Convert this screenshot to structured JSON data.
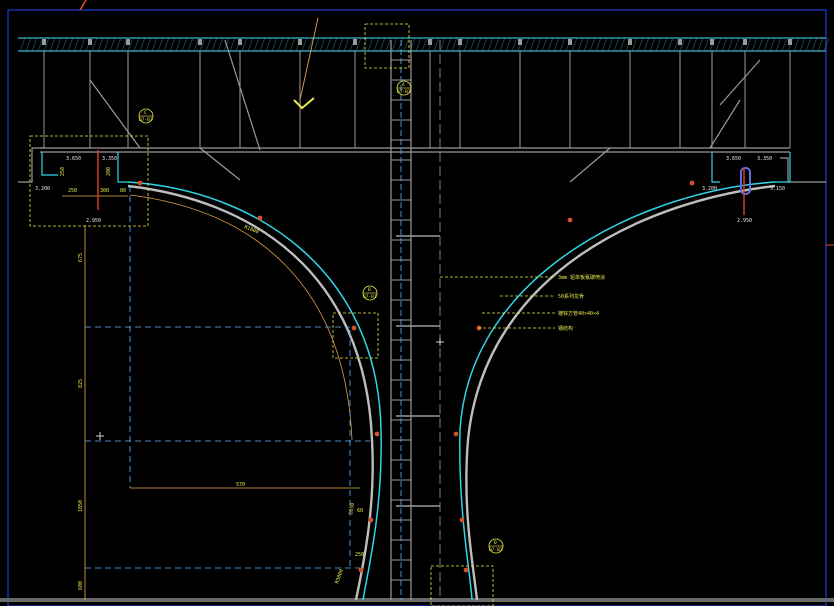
{
  "drawing": {
    "colors": {
      "background": "#000000",
      "frame": "#1f3bd6",
      "slab": "#3fb8c8",
      "structure": "#9a9a9a",
      "cladding": "#2fd6ea",
      "node": "#d2502a",
      "dimension": "#e0b040",
      "annotation": "#e8e84a",
      "centerline": "#5ab4ff"
    },
    "detail_bubbles": [
      {
        "num": "A",
        "sheet": "D7-B1"
      },
      {
        "num": "C",
        "sheet": "D7-B1"
      },
      {
        "num": "B",
        "sheet": "D7-B1"
      },
      {
        "num": "D",
        "sheet": "D7-B2"
      }
    ],
    "levels": {
      "left_upper_1": "3.650",
      "left_upper_2": "3.350",
      "left_lower": "3.200",
      "left_bottom": "2.950",
      "right_upper_1": "3.650",
      "right_upper_2": "3.350",
      "right_lower": "3.200",
      "right_side": "3.150",
      "right_bottom": "2.950"
    },
    "annotations": [
      "3mm 铝单板氟碳喷涂",
      "50系列龙骨",
      "镀锌方管40×40×4",
      "钢结构"
    ],
    "dimensions": {
      "vertical": [
        "675",
        "825",
        "1050",
        "600"
      ],
      "horizontal": [
        "570",
        "250",
        "300"
      ],
      "small": [
        "250",
        "200",
        "80",
        "60",
        "1050",
        "250"
      ],
      "arc_left": "R1800",
      "arc_lower": "R5000"
    }
  }
}
